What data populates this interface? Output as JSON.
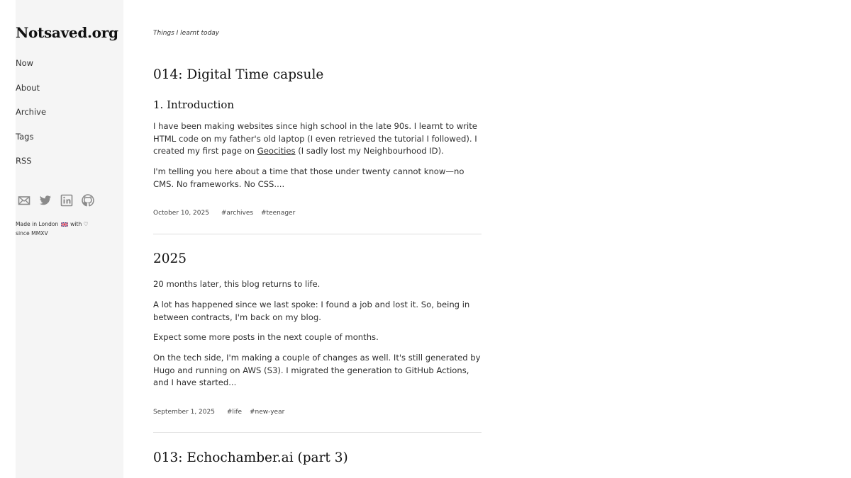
{
  "sidebar": {
    "site_title": "Notsaved.org",
    "nav": [
      {
        "label": "Now"
      },
      {
        "label": "About"
      },
      {
        "label": "Archive"
      },
      {
        "label": "Tags"
      },
      {
        "label": "RSS"
      }
    ],
    "social_icons": [
      "mail-icon",
      "twitter-icon",
      "linkedin-icon",
      "github-icon"
    ],
    "footer": {
      "made_in": "Made in London",
      "with": "with",
      "heart": "♡",
      "since": "since MMXV"
    }
  },
  "main": {
    "tagline": "Things I learnt today",
    "posts": [
      {
        "title": "014: Digital Time capsule",
        "subheading": "1. Introduction",
        "p1_before_link": "I have been making websites since high school in the late 90s. I learnt to write HTML code on my father's old laptop (I even retrieved the tutorial I followed). I created my first page on ",
        "p1_link": "Geocities",
        "p1_after_link": " (I sadly lost my Neighbourhood ID).",
        "p2": "I'm telling you here about a time that those under twenty cannot know—no CMS. No frameworks. No CSS....",
        "date": "October 10, 2025",
        "tags": [
          "#archives",
          "#teenager"
        ]
      },
      {
        "title": "2025",
        "paragraphs": [
          "20 months later, this blog returns to life.",
          "A lot has happened since we last spoke: I found a job and lost it. So, being in between contracts, I'm back on my blog.",
          "Expect some more posts in the next couple of months.",
          "On the tech side, I'm making a couple of changes as well. It's still generated by Hugo and running on AWS (S3). I migrated the generation to GitHub Actions, and I have started..."
        ],
        "date": "September 1, 2025",
        "tags": [
          "#life",
          "#new-year"
        ]
      },
      {
        "title": "013: Echochamber.ai (part 3)"
      }
    ]
  }
}
